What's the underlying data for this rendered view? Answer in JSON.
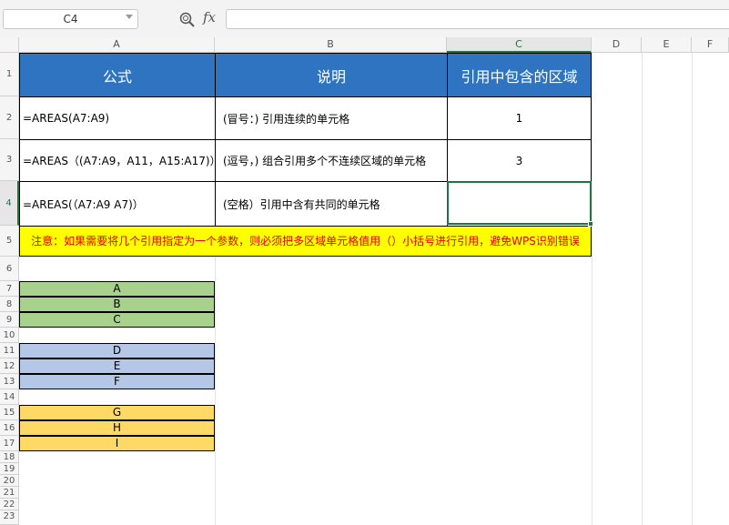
{
  "name_box": "C4",
  "formula_bar": {
    "fx_label": "fx",
    "value": ""
  },
  "columns": [
    "A",
    "B",
    "C",
    "D",
    "E",
    "F"
  ],
  "rows": [
    "1",
    "2",
    "3",
    "4",
    "5",
    "6",
    "7",
    "8",
    "9",
    "10",
    "11",
    "12",
    "13",
    "14",
    "15",
    "16",
    "17",
    "18",
    "19",
    "20",
    "21",
    "22",
    "23"
  ],
  "table": {
    "headers": [
      "公式",
      "说明",
      "引用中包含的区域"
    ],
    "rows": [
      [
        "=AREAS(A7:A9)",
        "(冒号：) 引用连续的单元格",
        "1"
      ],
      [
        "=AREAS（(A7:A9，A11，A15:A17)）",
        "(逗号，) 组合引用多个不连续区域的单元格",
        "3"
      ],
      [
        "=AREAS(（A7:A9 A7)）",
        "(空格）引用中含有共同的单元格",
        ""
      ]
    ]
  },
  "note": "注意：如果需要将几个引用指定为一个参数，则必须把多区域单元格值用（）小括号进行引用，避免WPS识别错误",
  "blocks": {
    "green": [
      "A",
      "B",
      "C"
    ],
    "blue": [
      "D",
      "E",
      "F"
    ],
    "orange": [
      "G",
      "H",
      "I"
    ]
  },
  "colors": {
    "header_fill": "#2e74c1",
    "note_fill": "#ffff00",
    "note_text": "#e60000",
    "green_fill": "#a9d18e",
    "blue_fill": "#b4c7e7",
    "orange_fill": "#ffd966",
    "selection": "#217346"
  }
}
